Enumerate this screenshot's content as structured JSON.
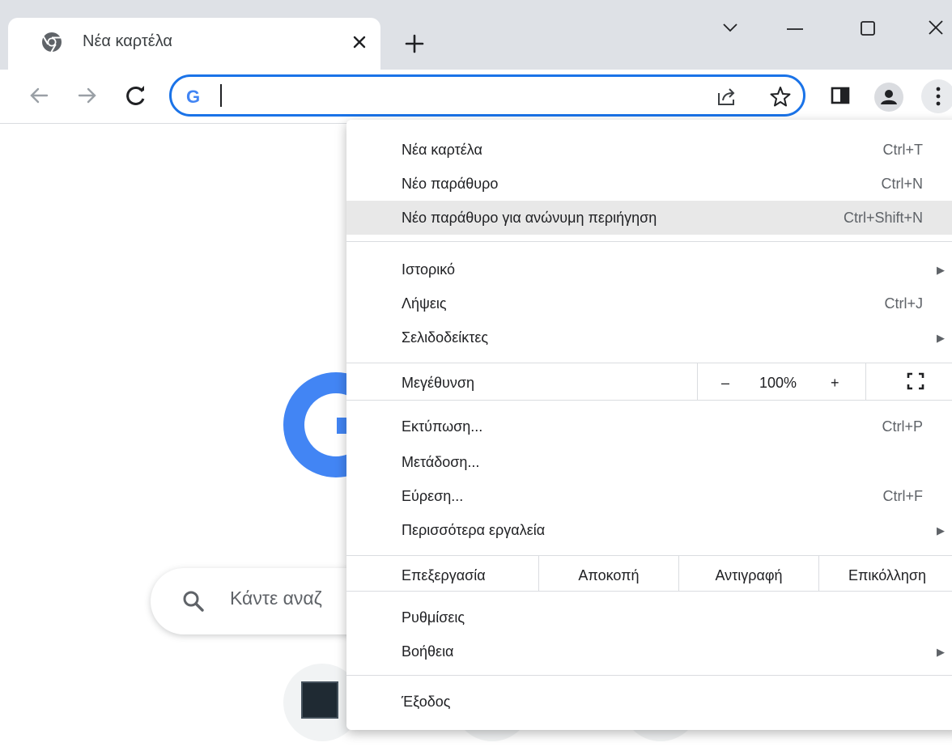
{
  "tab": {
    "title": "Νέα καρτέλα"
  },
  "omnibox": {
    "value": ""
  },
  "search": {
    "placeholder": "Κάντε αναζ"
  },
  "menu": {
    "group1": [
      {
        "label": "Νέα καρτέλα",
        "shortcut": "Ctrl+T"
      },
      {
        "label": "Νέο παράθυρο",
        "shortcut": "Ctrl+N"
      },
      {
        "label": "Νέο παράθυρο για ανώνυμη περιήγηση",
        "shortcut": "Ctrl+Shift+N"
      }
    ],
    "group2": [
      {
        "label": "Ιστορικό",
        "shortcut": ""
      },
      {
        "label": "Λήψεις",
        "shortcut": "Ctrl+J"
      },
      {
        "label": "Σελιδοδείκτες",
        "shortcut": ""
      }
    ],
    "zoom": {
      "label": "Μεγέθυνση",
      "minus": "–",
      "value": "100%",
      "plus": "+"
    },
    "group3": [
      {
        "label": "Εκτύπωση...",
        "shortcut": "Ctrl+P"
      },
      {
        "label": "Μετάδοση...",
        "shortcut": ""
      },
      {
        "label": "Εύρεση...",
        "shortcut": "Ctrl+F"
      },
      {
        "label": "Περισσότερα εργαλεία",
        "shortcut": ""
      }
    ],
    "edit": {
      "label": "Επεξεργασία",
      "cut": "Αποκοπή",
      "copy": "Αντιγραφή",
      "paste": "Επικόλληση"
    },
    "group4": [
      {
        "label": "Ρυθμίσεις",
        "shortcut": ""
      },
      {
        "label": "Βοήθεια",
        "shortcut": ""
      }
    ],
    "exit": {
      "label": "Έξοδος"
    }
  }
}
